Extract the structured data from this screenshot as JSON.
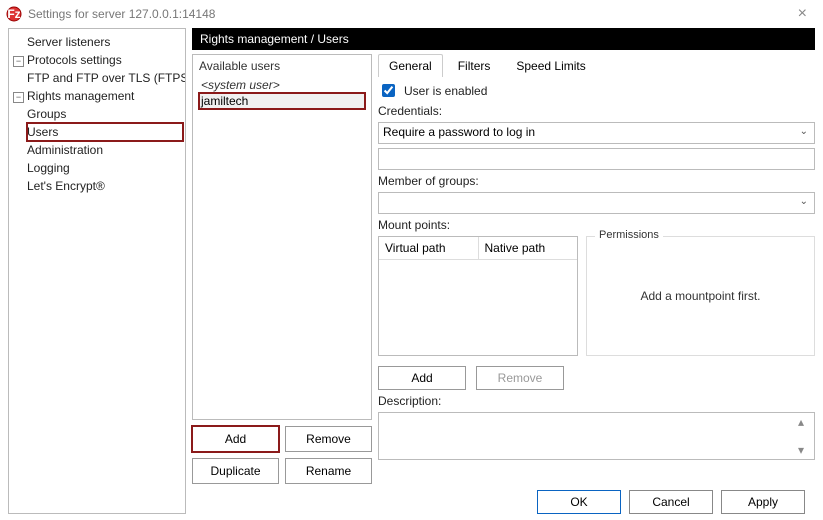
{
  "window": {
    "title": "Settings for server 127.0.0.1:14148"
  },
  "tree": {
    "server_listeners": "Server listeners",
    "protocols_settings": "Protocols settings",
    "ftp_tls": "FTP and FTP over TLS (FTPS)",
    "rights_management": "Rights management",
    "groups": "Groups",
    "users": "Users",
    "administration": "Administration",
    "logging": "Logging",
    "lets_encrypt": "Let's Encrypt®"
  },
  "header": {
    "title": "Rights management / Users"
  },
  "usersPanel": {
    "title": "Available users",
    "items": [
      "<system user>",
      "jamiltech"
    ],
    "buttons": {
      "add": "Add",
      "remove": "Remove",
      "duplicate": "Duplicate",
      "rename": "Rename"
    }
  },
  "tabs": {
    "general": "General",
    "filters": "Filters",
    "speed": "Speed Limits"
  },
  "form": {
    "enabled_label": "User is enabled",
    "enabled_checked": true,
    "credentials_label": "Credentials:",
    "credentials_value": "Require a password to log in",
    "password_value": "",
    "member_groups_label": "Member of groups:",
    "member_groups_value": "",
    "mount_label": "Mount points:",
    "mount_headers": {
      "virtual": "Virtual path",
      "native": "Native path"
    },
    "permissions_label": "Permissions",
    "permissions_msg": "Add a mountpoint first.",
    "mount_buttons": {
      "add": "Add",
      "remove": "Remove"
    },
    "description_label": "Description:"
  },
  "footer": {
    "ok": "OK",
    "cancel": "Cancel",
    "apply": "Apply"
  }
}
